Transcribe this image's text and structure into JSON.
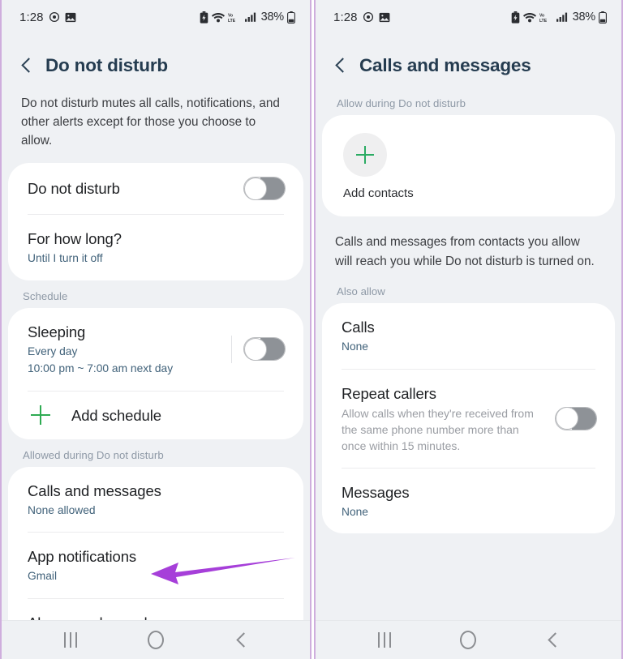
{
  "status_bar": {
    "time": "1:28",
    "icons_left": [
      "alarm-icon",
      "gallery-icon"
    ],
    "icons_right": [
      "battery-saver-icon",
      "wifi-icon",
      "volte-icon",
      "signal-icon"
    ],
    "battery_percent": "38%",
    "volte_label": "VoLTE"
  },
  "nav_bar": {
    "recents_label": "Recents",
    "home_label": "Home",
    "back_label": "Back"
  },
  "left_panel": {
    "title": "Do not disturb",
    "intro": "Do not disturb mutes all calls, notifications, and other alerts except for those you choose to allow.",
    "cards": [
      {
        "rows": [
          {
            "title": "Do not disturb",
            "sub": "",
            "control": "toggle",
            "toggle_on": false
          },
          {
            "title": "For how long?",
            "sub": "Until I turn it off",
            "control": "none"
          }
        ]
      }
    ],
    "schedule_label": "Schedule",
    "schedule_card": {
      "rows": [
        {
          "title": "Sleeping",
          "sub": "Every day",
          "sub2": "10:00 pm ~ 7:00 am next day",
          "control": "toggle",
          "toggle_on": false
        },
        {
          "title": "Add schedule",
          "control": "plus"
        }
      ]
    },
    "allowed_label": "Allowed during Do not disturb",
    "allowed_card": {
      "rows": [
        {
          "title": "Calls and messages",
          "sub": "None allowed"
        },
        {
          "title": "App notifications",
          "sub": "Gmail"
        },
        {
          "title": "Alarms and sounds",
          "sub": ""
        }
      ]
    }
  },
  "right_panel": {
    "title": "Calls and messages",
    "allow_label": "Allow during Do not disturb",
    "add_contacts": {
      "icon": "plus-icon",
      "label": "Add contacts"
    },
    "note": "Calls and messages from contacts you allow will reach you while Do not disturb is turned on.",
    "also_allow_label": "Also allow",
    "also_allow_card": {
      "rows": [
        {
          "title": "Calls",
          "sub": "None",
          "control": "none"
        },
        {
          "title": "Repeat callers",
          "sub": "Allow calls when they're received from the same phone number more than once within 15 minutes.",
          "control": "toggle",
          "toggle_on": false
        },
        {
          "title": "Messages",
          "sub": "None",
          "control": "none"
        }
      ]
    }
  },
  "annotations": {
    "arrow_color": "#a63fd9",
    "arrow_left_target": "Calls and messages",
    "arrow_right_target": "Add contacts"
  },
  "colors": {
    "accent_green": "#2eab52",
    "title_blue": "#253c50",
    "subtitle_blue": "#41627a",
    "section_label": "#8e99a6",
    "page_bg": "#eff1f4",
    "card_bg": "#ffffff",
    "frame_border": "#cfaedd"
  }
}
